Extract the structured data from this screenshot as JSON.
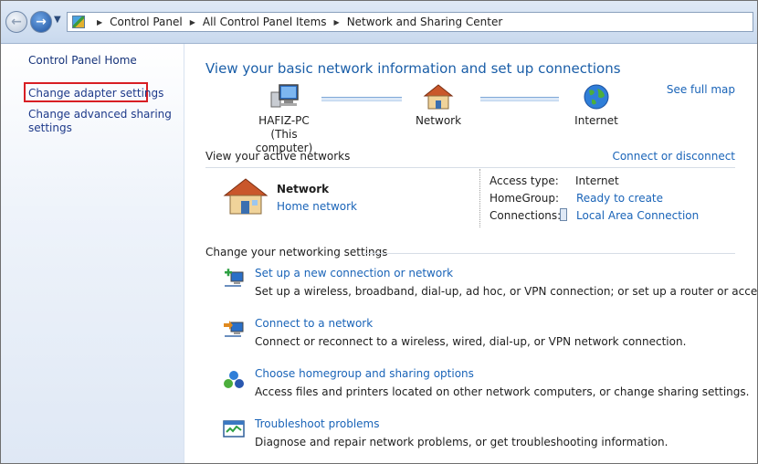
{
  "breadcrumb": [
    "Control Panel",
    "All Control Panel Items",
    "Network and Sharing Center"
  ],
  "sidebar": {
    "home": "Control Panel Home",
    "links": [
      "Change adapter settings",
      "Change advanced sharing",
      "settings"
    ]
  },
  "main": {
    "title": "View your basic network information and set up connections",
    "see_full_map": "See full map",
    "nodes": {
      "computer": "HAFIZ-PC",
      "computer_sub": "(This computer)",
      "network": "Network",
      "internet": "Internet"
    },
    "active_label": "View your active networks",
    "connect_disconnect": "Connect or disconnect",
    "network": {
      "name": "Network",
      "type": "Home network"
    },
    "details": {
      "access_label": "Access type:",
      "access_value": "Internet",
      "homegroup_label": "HomeGroup:",
      "homegroup_value": "Ready to create",
      "connections_label": "Connections:",
      "connections_value": "Local Area Connection"
    },
    "change_label": "Change your networking settings",
    "tasks": [
      {
        "label": "Set up a new connection or network",
        "desc": "Set up a wireless, broadband, dial-up, ad hoc, or VPN connection; or set up a router or access point.",
        "icon": "new-connection-icon"
      },
      {
        "label": "Connect to a network",
        "desc": "Connect or reconnect to a wireless, wired, dial-up, or VPN network connection.",
        "icon": "connect-network-icon"
      },
      {
        "label": "Choose homegroup and sharing options",
        "desc": "Access files and printers located on other network computers, or change sharing settings.",
        "icon": "homegroup-icon"
      },
      {
        "label": "Troubleshoot problems",
        "desc": "Diagnose and repair network problems, or get troubleshooting information.",
        "icon": "troubleshoot-icon"
      }
    ]
  },
  "colors": {
    "link": "#1a64b8",
    "title": "#1a5ea8",
    "highlight": "#d81e24"
  }
}
